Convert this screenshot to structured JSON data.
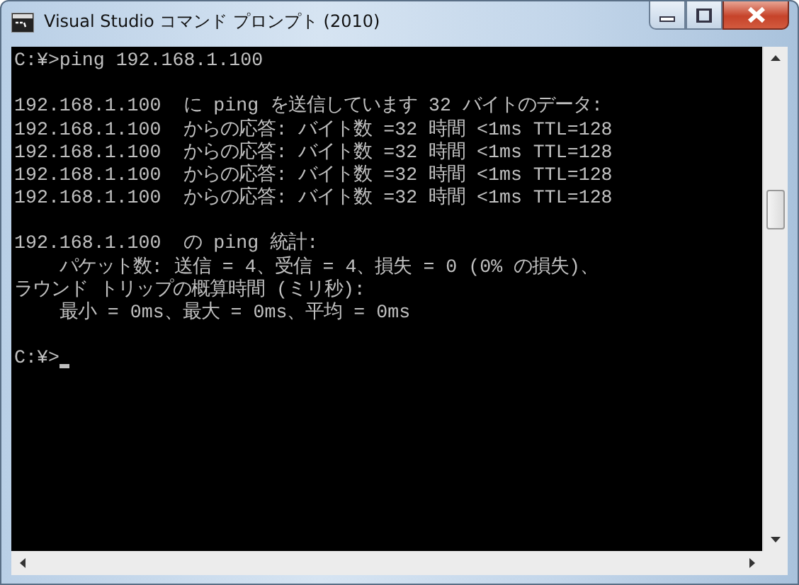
{
  "window": {
    "title": "Visual Studio コマンド プロンプト (2010)"
  },
  "console": {
    "blocks": [
      [
        "C:¥>ping 192.168.1.100"
      ],
      [
        "192.168.1.100  に ping を送信しています 32 バイトのデータ:",
        "192.168.1.100  からの応答: バイト数 =32 時間 <1ms TTL=128",
        "192.168.1.100  からの応答: バイト数 =32 時間 <1ms TTL=128",
        "192.168.1.100  からの応答: バイト数 =32 時間 <1ms TTL=128",
        "192.168.1.100  からの応答: バイト数 =32 時間 <1ms TTL=128"
      ],
      [
        "192.168.1.100  の ping 統計:",
        "    パケット数: 送信 = 4、受信 = 4、損失 = 0 (0% の損失)、",
        "ラウンド トリップの概算時間 (ミリ秒):",
        "    最小 = 0ms、最大 = 0ms、平均 = 0ms"
      ],
      [
        "C:¥>"
      ]
    ],
    "cursor": true
  }
}
